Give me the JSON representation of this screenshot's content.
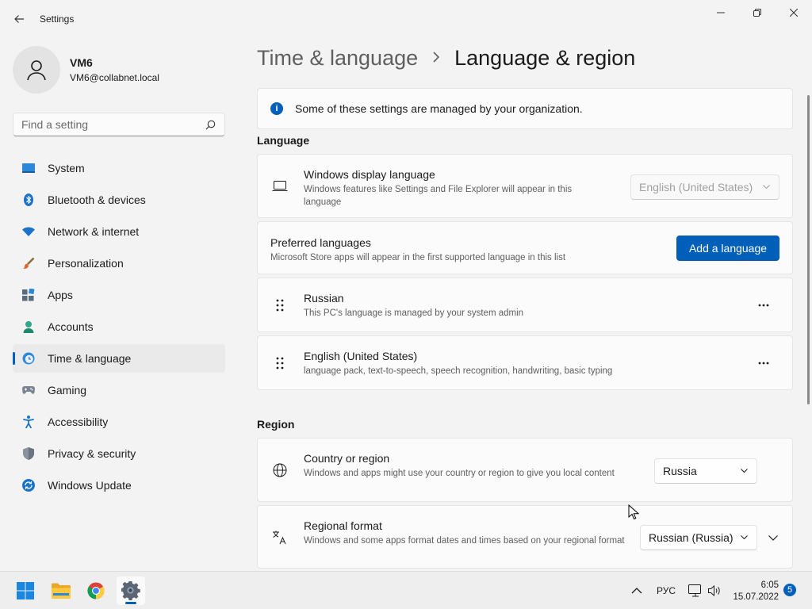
{
  "window": {
    "title": "Settings"
  },
  "profile": {
    "name": "VM6",
    "email": "VM6@collabnet.local"
  },
  "search": {
    "placeholder": "Find a setting"
  },
  "sidebar": {
    "items": [
      {
        "label": "System",
        "icon": "system-icon"
      },
      {
        "label": "Bluetooth & devices",
        "icon": "bluetooth-icon"
      },
      {
        "label": "Network & internet",
        "icon": "wifi-icon"
      },
      {
        "label": "Personalization",
        "icon": "brush-icon"
      },
      {
        "label": "Apps",
        "icon": "apps-icon"
      },
      {
        "label": "Accounts",
        "icon": "accounts-icon"
      },
      {
        "label": "Time & language",
        "icon": "time-language-icon",
        "active": true
      },
      {
        "label": "Gaming",
        "icon": "gamepad-icon"
      },
      {
        "label": "Accessibility",
        "icon": "accessibility-icon"
      },
      {
        "label": "Privacy & security",
        "icon": "shield-icon"
      },
      {
        "label": "Windows Update",
        "icon": "update-icon"
      }
    ]
  },
  "breadcrumb": {
    "parent": "Time & language",
    "current": "Language & region"
  },
  "info_banner": {
    "text": "Some of these settings are managed by your organization."
  },
  "language": {
    "section_title": "Language",
    "display_language": {
      "title": "Windows display language",
      "subtitle": "Windows features like Settings and File Explorer will appear in this language",
      "value": "English (United States)"
    },
    "preferred": {
      "title": "Preferred languages",
      "subtitle": "Microsoft Store apps will appear in the first supported language in this list",
      "button": "Add a language"
    },
    "languages": [
      {
        "name": "Russian",
        "detail": "This PC's language is managed by your system admin"
      },
      {
        "name": "English (United States)",
        "detail": "language pack, text-to-speech, speech recognition, handwriting, basic typing"
      }
    ]
  },
  "region": {
    "section_title": "Region",
    "country": {
      "title": "Country or region",
      "subtitle": "Windows and apps might use your country or region to give you local content",
      "value": "Russia"
    },
    "format": {
      "title": "Regional format",
      "subtitle": "Windows and some apps format dates and times based on your regional format",
      "value": "Russian (Russia)"
    }
  },
  "taskbar": {
    "keyboard_layout": "РУС",
    "time": "6:05",
    "date": "15.07.2022",
    "notification_count": "5"
  },
  "colors": {
    "accent": "#005fb8",
    "background": "#f3f3f3",
    "card": "#fbfbfb"
  }
}
